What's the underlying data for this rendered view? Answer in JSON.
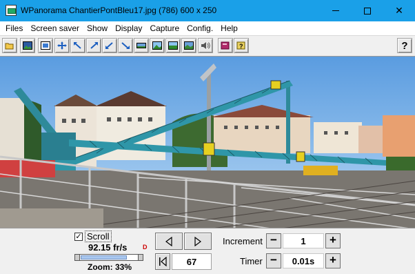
{
  "window": {
    "title": "WPanorama  ChantierPontBleu17.jpg  (786) 600 x 250",
    "minimize_icon": "minimize-icon",
    "maximize_icon": "maximize-icon",
    "close_label": "✕"
  },
  "menu": [
    "Files",
    "Screen saver",
    "Show",
    "Display",
    "Capture",
    "Config.",
    "Help"
  ],
  "toolbar": {
    "buttons": [
      {
        "icon": "open-folder-icon"
      },
      {
        "icon": "picture-icon"
      },
      {
        "icon": "fit-window-icon"
      },
      {
        "icon": "move-icon"
      },
      {
        "icon": "arrow-up-left-icon"
      },
      {
        "icon": "arrow-up-right-icon"
      },
      {
        "icon": "arrow-down-left-icon"
      },
      {
        "icon": "arrow-down-right-icon"
      },
      {
        "icon": "panorama-strip-icon"
      },
      {
        "icon": "landscape-icon"
      },
      {
        "icon": "horizon-icon"
      },
      {
        "icon": "film-icon"
      },
      {
        "icon": "speaker-icon"
      },
      {
        "icon": "book-icon"
      },
      {
        "icon": "help-book-icon"
      }
    ],
    "help_label": "?"
  },
  "picture": {
    "description_icon": "panorama-image"
  },
  "controls": {
    "scroll_checked": "✓",
    "scroll_label": "Scroll",
    "fps": "92.15 fr/s",
    "fps_icon": "D",
    "speed_level": 0.8,
    "zoom": "Zoom: 33%",
    "frame": "67",
    "increment_label": "Increment",
    "increment_value": "1",
    "timer_label": "Timer",
    "timer_value": "0.01s",
    "minus": "−",
    "plus": "+"
  }
}
